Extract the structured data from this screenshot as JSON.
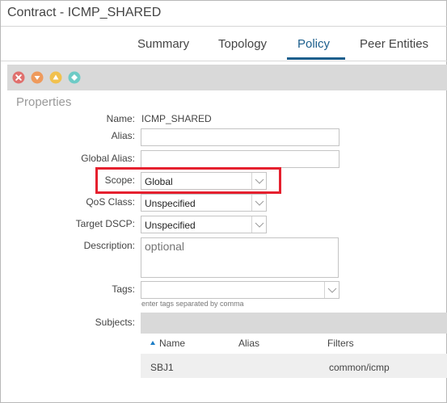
{
  "window": {
    "title": "Contract - ICMP_SHARED"
  },
  "tabs": [
    {
      "label": "Summary"
    },
    {
      "label": "Topology"
    },
    {
      "label": "Policy"
    },
    {
      "label": "Peer Entities"
    }
  ],
  "active_tab": "Policy",
  "toolbar": {
    "icons": [
      "critical-fault-icon",
      "major-fault-icon",
      "minor-fault-icon",
      "warning-fault-icon"
    ],
    "colors": {
      "critical": "#e0706e",
      "major": "#ee9a5c",
      "minor": "#f1c14e",
      "warning": "#6ecbc6"
    }
  },
  "section": {
    "title": "Properties"
  },
  "form": {
    "name": {
      "label": "Name:",
      "value": "ICMP_SHARED"
    },
    "alias": {
      "label": "Alias:",
      "value": ""
    },
    "global_alias": {
      "label": "Global Alias:",
      "value": ""
    },
    "scope": {
      "label": "Scope:",
      "value": "Global"
    },
    "qos_class": {
      "label": "QoS Class:",
      "value": "Unspecified"
    },
    "target_dscp": {
      "label": "Target DSCP:",
      "value": "Unspecified"
    },
    "description": {
      "label": "Description:",
      "placeholder": "optional"
    },
    "tags": {
      "label": "Tags:",
      "value": "",
      "hint": "enter tags separated by comma"
    }
  },
  "subjects": {
    "label": "Subjects:",
    "columns": [
      "Name",
      "Alias",
      "Filters"
    ],
    "rows": [
      {
        "name": "SBJ1",
        "alias": "",
        "filters": "common/icmp"
      }
    ]
  },
  "highlight_color": "#e5202e"
}
